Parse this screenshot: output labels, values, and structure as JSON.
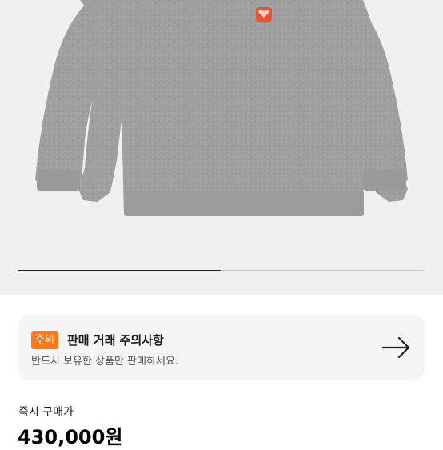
{
  "carousel": {
    "image_alt": "gray knit sweater with heart patch",
    "progress_fraction": 0.5
  },
  "notice": {
    "badge": "주의",
    "title": "판매 거래 주의사항",
    "description": "반드시 보유한 상품만 판매하세요.",
    "arrow_icon": "arrow-right-icon"
  },
  "price": {
    "label": "즉시 구매가",
    "value": "430,000원"
  },
  "colors": {
    "image_background": "#f0f0f0",
    "sweater": "#9e9e9e",
    "badge": "#ff7a16",
    "patch": "#e8552b",
    "card_background": "#f5f5f6"
  }
}
